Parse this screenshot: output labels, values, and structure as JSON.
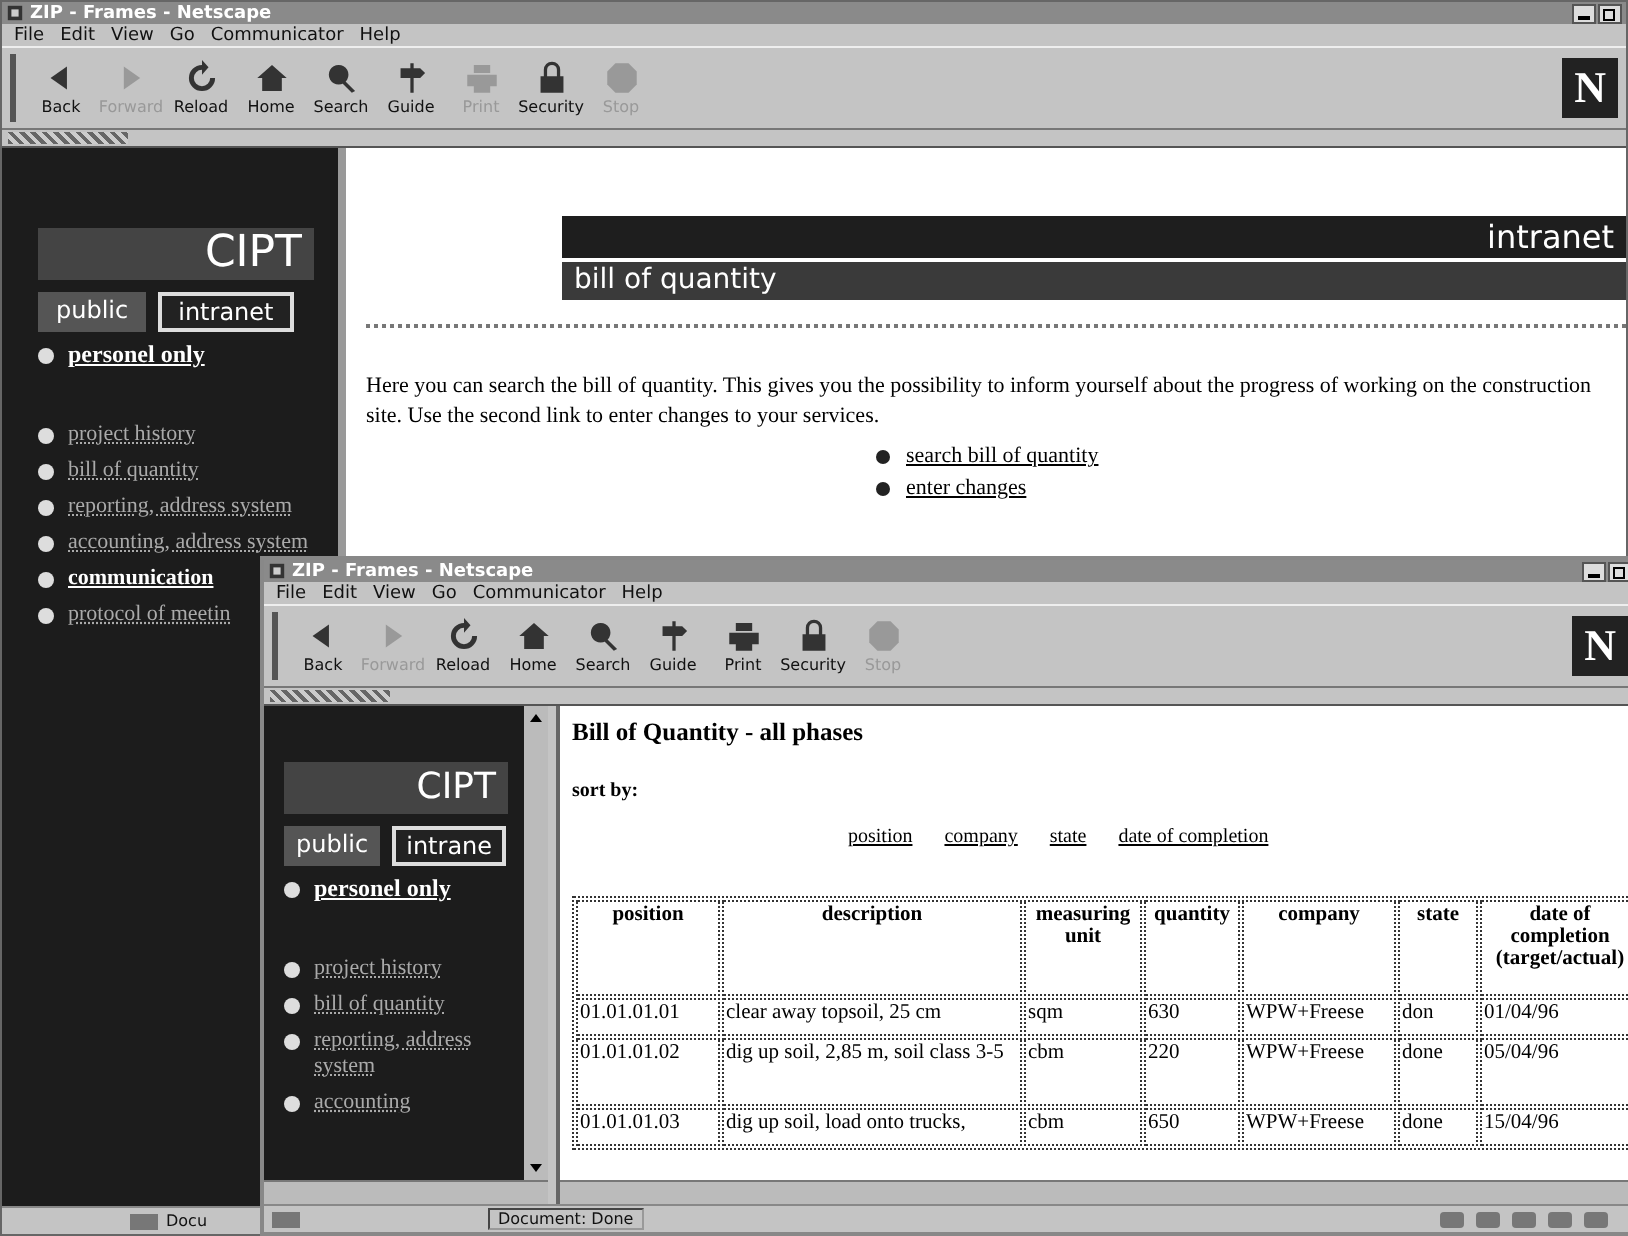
{
  "back_window": {
    "title": "ZIP - Frames - Netscape",
    "logo": "N",
    "menu": [
      "File",
      "Edit",
      "View",
      "Go",
      "Communicator",
      "Help"
    ],
    "toolbar": [
      {
        "label": "Back",
        "disabled": false
      },
      {
        "label": "Forward",
        "disabled": true
      },
      {
        "label": "Reload",
        "disabled": false
      },
      {
        "label": "Home",
        "disabled": false
      },
      {
        "label": "Search",
        "disabled": false
      },
      {
        "label": "Guide",
        "disabled": false
      },
      {
        "label": "Print",
        "disabled": true
      },
      {
        "label": "Security",
        "disabled": false
      },
      {
        "label": "Stop",
        "disabled": true
      }
    ],
    "sidebar": {
      "logo": "CIPT",
      "tabs": [
        {
          "label": "public",
          "selected": false
        },
        {
          "label": "intranet",
          "selected": true
        }
      ],
      "heading_link": "personel only",
      "items": [
        {
          "label": "project history",
          "highlighted": false
        },
        {
          "label": "bill of quantity",
          "highlighted": false
        },
        {
          "label": "reporting, address system",
          "highlighted": false
        },
        {
          "label": "accounting, address system",
          "highlighted": false
        },
        {
          "label": "communication",
          "highlighted": true
        },
        {
          "label": "protocol of meetin",
          "highlighted": false
        }
      ]
    },
    "banner": {
      "site": "intranet",
      "page": "bill of quantity"
    },
    "intro": "Here you can search the bill of quantity. This gives you the possibility to inform yourself about the progress of working on the construction site. Use the second link to enter changes to your services.",
    "links": [
      "search bill of quantity",
      "enter changes"
    ],
    "status": "Docu"
  },
  "front_window": {
    "title": "ZIP - Frames - Netscape",
    "logo": "N",
    "menu": [
      "File",
      "Edit",
      "View",
      "Go",
      "Communicator",
      "Help"
    ],
    "toolbar": [
      {
        "label": "Back",
        "disabled": false
      },
      {
        "label": "Forward",
        "disabled": true
      },
      {
        "label": "Reload",
        "disabled": false
      },
      {
        "label": "Home",
        "disabled": false
      },
      {
        "label": "Search",
        "disabled": false
      },
      {
        "label": "Guide",
        "disabled": false
      },
      {
        "label": "Print",
        "disabled": false
      },
      {
        "label": "Security",
        "disabled": false
      },
      {
        "label": "Stop",
        "disabled": true
      }
    ],
    "sidebar": {
      "logo": "CIPT",
      "tabs": [
        {
          "label": "public",
          "selected": false
        },
        {
          "label": "intrane",
          "selected": true
        }
      ],
      "heading_link": "personel only",
      "items": [
        {
          "label": "project history",
          "highlighted": false
        },
        {
          "label": "bill of quantity",
          "highlighted": false
        },
        {
          "label": "reporting, address system",
          "highlighted": false
        },
        {
          "label": "accounting",
          "highlighted": false
        }
      ]
    },
    "heading": "Bill of Quantity - all phases",
    "sort_label": "sort by:",
    "sort_links": [
      "position",
      "company",
      "state",
      "date of completion"
    ],
    "table": {
      "columns": [
        "position",
        "description",
        "measuring unit",
        "quantity",
        "company",
        "state",
        "date of completion (target/actual)"
      ],
      "rows": [
        [
          "01.01.01.01",
          "clear away topsoil, 25 cm",
          "sqm",
          "630",
          "WPW+Freese",
          "don",
          "01/04/96"
        ],
        [
          "01.01.01.02",
          "dig up soil, 2,85 m, soil class 3-5",
          "cbm",
          "220",
          "WPW+Freese",
          "done",
          "05/04/96"
        ],
        [
          "01.01.01.03",
          "dig up soil, load onto trucks,",
          "cbm",
          "650",
          "WPW+Freese",
          "done",
          "15/04/96"
        ]
      ]
    },
    "status": "Document: Done"
  }
}
